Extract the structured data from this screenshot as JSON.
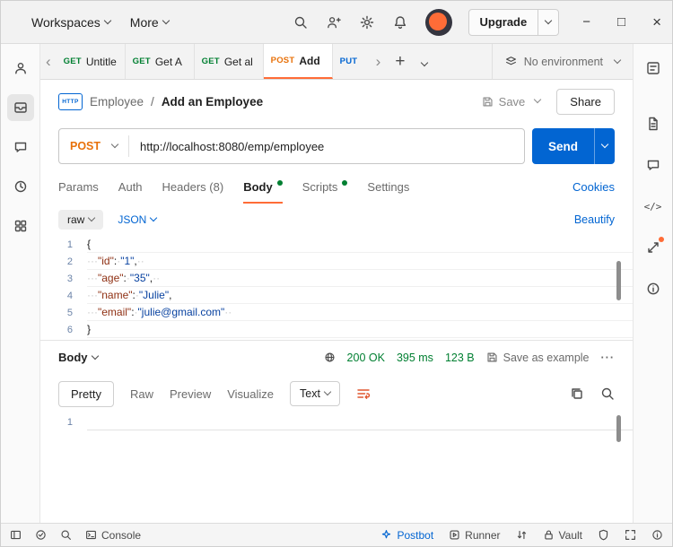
{
  "titlebar": {
    "workspaces_label": "Workspaces",
    "more_label": "More",
    "upgrade_label": "Upgrade"
  },
  "tabbar": {
    "tabs": [
      {
        "method": "GET",
        "title": "Untitle",
        "active": false
      },
      {
        "method": "GET",
        "title": "Get A",
        "active": false
      },
      {
        "method": "GET",
        "title": "Get al",
        "active": false
      },
      {
        "method": "POST",
        "title": "Add",
        "active": true
      },
      {
        "method": "PUT",
        "title": "",
        "active": false
      }
    ],
    "environment_label": "No environment"
  },
  "breadcrumb": {
    "collection": "Employee",
    "separator": "/",
    "request_name": "Add an Employee",
    "save_label": "Save",
    "share_label": "Share"
  },
  "request_bar": {
    "method": "POST",
    "url": "http://localhost:8080/emp/employee",
    "send_label": "Send"
  },
  "request_tabs": [
    {
      "label": "Params",
      "active": false,
      "dot": false
    },
    {
      "label": "Auth",
      "active": false,
      "dot": false
    },
    {
      "label": "Headers (8)",
      "active": false,
      "dot": false
    },
    {
      "label": "Body",
      "active": true,
      "dot": true
    },
    {
      "label": "Scripts",
      "active": false,
      "dot": true
    },
    {
      "label": "Settings",
      "active": false,
      "dot": false
    }
  ],
  "cookies_label": "Cookies",
  "body_toolbar": {
    "format": "raw",
    "language": "JSON",
    "beautify_label": "Beautify"
  },
  "request_editor": {
    "lines": [
      {
        "num": "1",
        "segments": [
          {
            "c": "punct",
            "t": "{"
          }
        ]
      },
      {
        "num": "2",
        "segments": [
          {
            "c": "ws",
            "t": "···"
          },
          {
            "c": "key",
            "t": "\"id\""
          },
          {
            "c": "punct",
            "t": ":"
          },
          {
            "c": "ws",
            "t": "·"
          },
          {
            "c": "str",
            "t": "\"1\""
          },
          {
            "c": "punct",
            "t": ","
          },
          {
            "c": "ws",
            "t": "··"
          }
        ]
      },
      {
        "num": "3",
        "segments": [
          {
            "c": "ws",
            "t": "···"
          },
          {
            "c": "key",
            "t": "\"age\""
          },
          {
            "c": "punct",
            "t": ":"
          },
          {
            "c": "ws",
            "t": "·"
          },
          {
            "c": "str",
            "t": "\"35\""
          },
          {
            "c": "punct",
            "t": ","
          },
          {
            "c": "ws",
            "t": "··"
          }
        ]
      },
      {
        "num": "4",
        "segments": [
          {
            "c": "ws",
            "t": "···"
          },
          {
            "c": "key",
            "t": "\"name\""
          },
          {
            "c": "punct",
            "t": ":"
          },
          {
            "c": "ws",
            "t": "·"
          },
          {
            "c": "str",
            "t": "\"Julie\""
          },
          {
            "c": "punct",
            "t": ","
          }
        ]
      },
      {
        "num": "5",
        "segments": [
          {
            "c": "ws",
            "t": "···"
          },
          {
            "c": "key",
            "t": "\"email\""
          },
          {
            "c": "punct",
            "t": ":"
          },
          {
            "c": "ws",
            "t": "·"
          },
          {
            "c": "str",
            "t": "\"julie@gmail.com\""
          },
          {
            "c": "ws",
            "t": "··"
          }
        ]
      },
      {
        "num": "6",
        "segments": [
          {
            "c": "punct",
            "t": "}"
          }
        ]
      }
    ]
  },
  "response": {
    "body_label": "Body",
    "status": "200 OK",
    "time": "395 ms",
    "size": "123 B",
    "save_as_example_label": "Save as example",
    "view_tabs": [
      {
        "label": "Pretty",
        "active": true
      },
      {
        "label": "Raw",
        "active": false
      },
      {
        "label": "Preview",
        "active": false
      },
      {
        "label": "Visualize",
        "active": false
      }
    ],
    "format": "Text",
    "editor_line": "1"
  },
  "statusbar": {
    "console_label": "Console",
    "postbot_label": "Postbot",
    "runner_label": "Runner",
    "vault_label": "Vault"
  },
  "colors": {
    "method_get": "#007f31",
    "method_post": "#e8710a",
    "method_put": "#0265d2",
    "accent_orange": "#ff6c37",
    "link_blue": "#0265d2",
    "status_green": "#007f31"
  }
}
